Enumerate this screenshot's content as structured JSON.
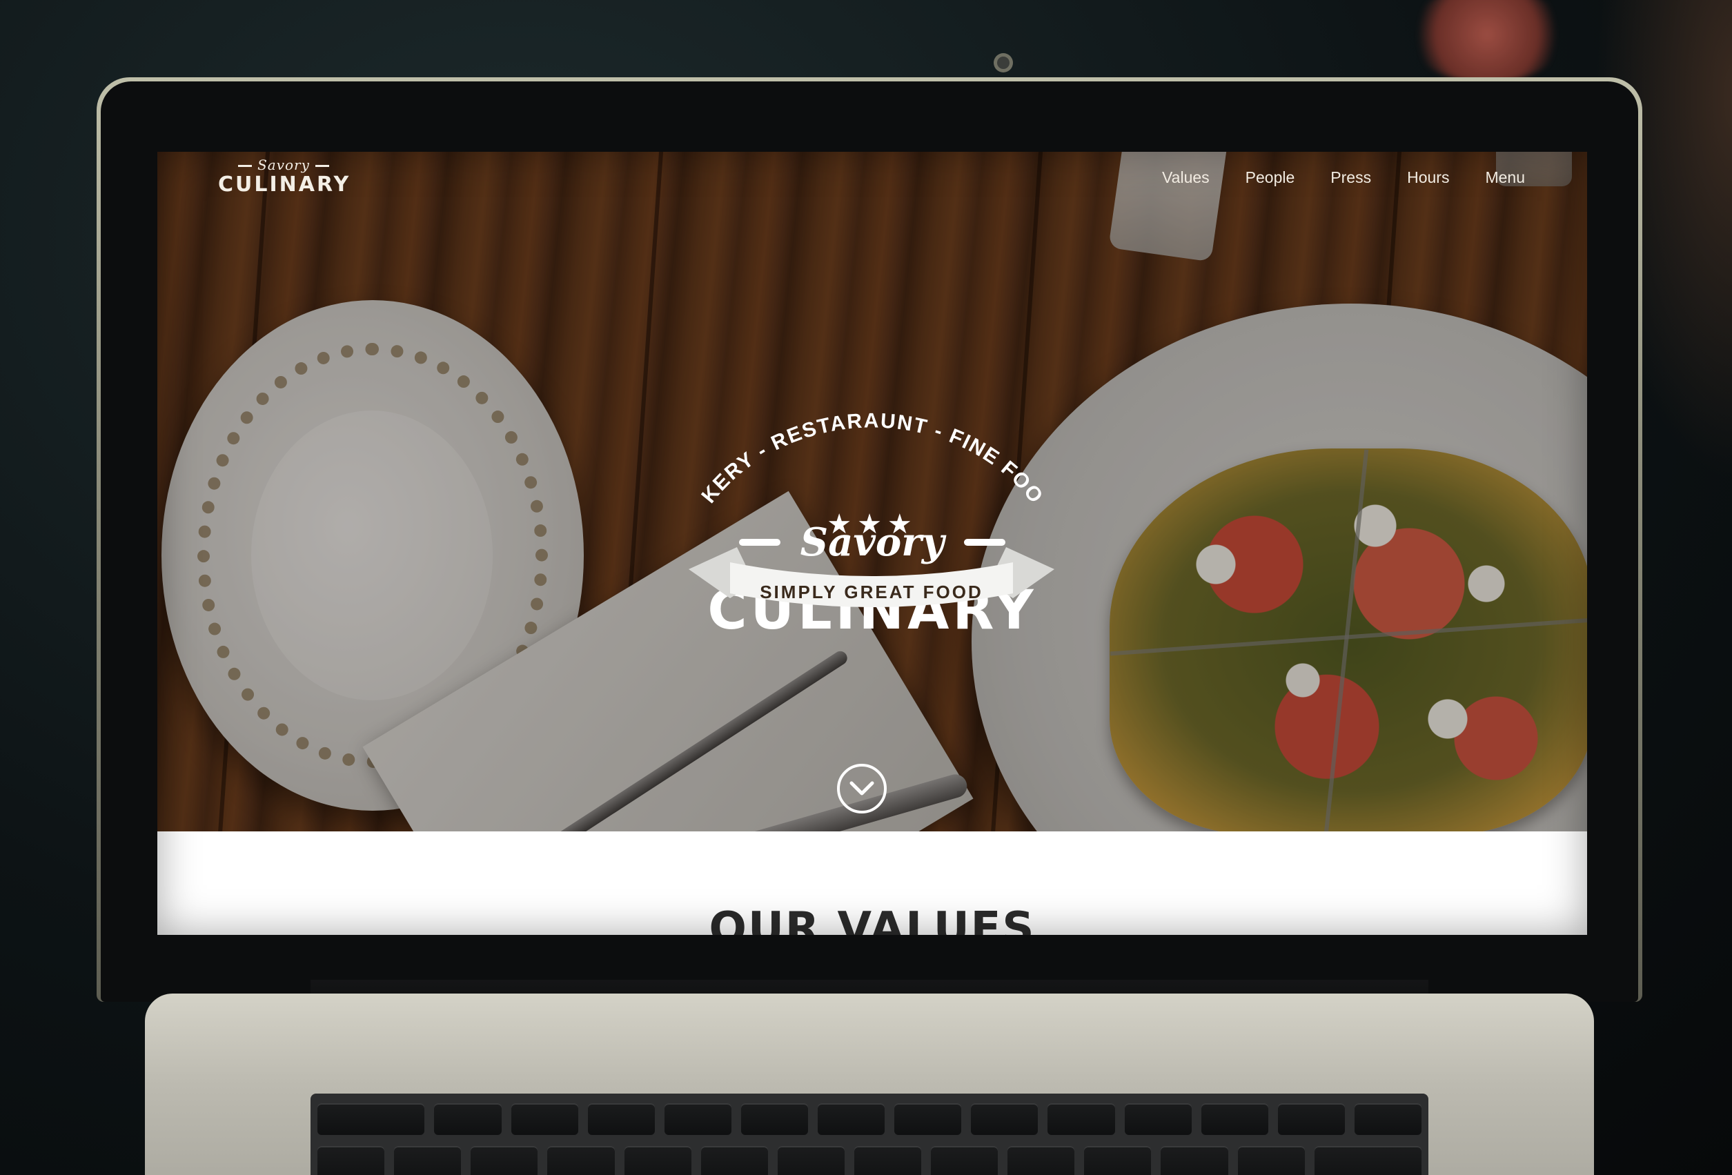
{
  "site": {
    "brand_small": {
      "script": "Savory",
      "word": "CULINARY"
    },
    "nav": [
      {
        "label": "Values"
      },
      {
        "label": "People"
      },
      {
        "label": "Press"
      },
      {
        "label": "Hours"
      },
      {
        "label": "Menu"
      }
    ],
    "hero": {
      "arc_text": "BAKERY - RESTARAUNT - FINE FOODS",
      "script": "Savory",
      "title": "CULINARY",
      "stars": "★★★",
      "ribbon_text": "SIMPLY GREAT FOOD",
      "scroll_icon": "chevron-down-icon"
    },
    "values_section": {
      "heading": "OUR VALUES"
    }
  },
  "colors": {
    "nav_text": "#f2ece2",
    "logo_white": "#ffffff",
    "ribbon_text": "#3a2a1c",
    "heading_text": "#2b2b2b"
  }
}
